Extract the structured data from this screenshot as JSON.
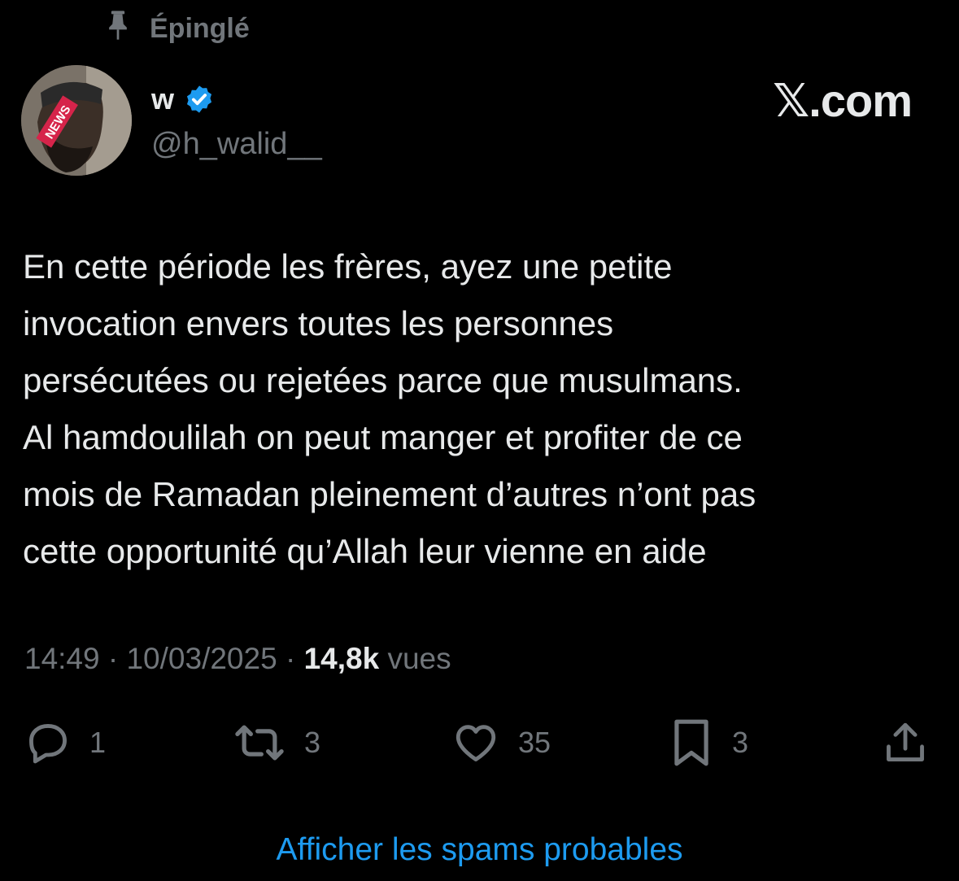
{
  "pinned_label": "Épinglé",
  "author": {
    "display_name": "w",
    "handle": "@h_walid__",
    "verified": true,
    "avatar_badge": "NEWS"
  },
  "brand_label": "𝕏.com",
  "tweet": {
    "text": "En cette période les frères, ayez une petite\ninvocation envers toutes les personnes\npersécutées ou rejetées parce que musulmans.\nAl hamdoulilah on peut manger et profiter de ce\nmois de Ramadan pleinement d’autres n’ont pas\ncette opportunité qu’Allah leur vienne en aide",
    "time": "14:49",
    "date": "10/03/2025",
    "separator": "·",
    "views_count": "14,8k",
    "views_label": "vues"
  },
  "actions": {
    "reply_count": "1",
    "repost_count": "3",
    "like_count": "35",
    "bookmark_count": "3"
  },
  "spam_link_label": "Afficher les spams probables",
  "colors": {
    "background": "#000000",
    "primary_text": "#e7e9ea",
    "secondary_text": "#71767b",
    "link": "#1d9bf0",
    "verified_badge": "#1d9bf0"
  }
}
